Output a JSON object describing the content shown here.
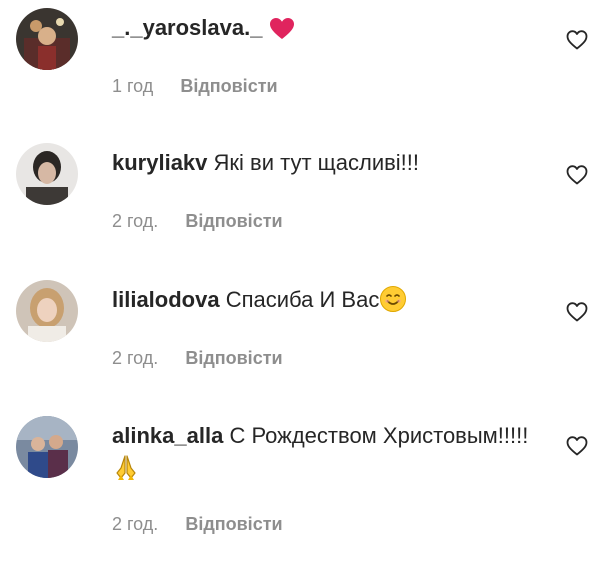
{
  "comments": [
    {
      "username": "_._yaroslava._",
      "text": "",
      "time": "1 год",
      "reply_label": "Відповісти",
      "trailing_icon": "red-heart-emoji"
    },
    {
      "username": "kuryliakv",
      "text": "Які ви тут щасливі!!!",
      "time": "2 год.",
      "reply_label": "Відповісти"
    },
    {
      "username": "lilialodova",
      "text": "Спасиба И Вас",
      "time": "2 год.",
      "reply_label": "Відповісти",
      "trailing_icon": "smiling-face-emoji"
    },
    {
      "username": "alinka_alla",
      "text": "С Рождеством Христовым!!!!!",
      "time": "2 год.",
      "reply_label": "Відповісти",
      "trailing_icon": "folded-hands-emoji"
    }
  ],
  "icons": {
    "like": "heart-outline-icon"
  },
  "colors": {
    "text": "#262626",
    "muted": "#8e8e8e",
    "heart_red": "#e0245e",
    "emoji_yellow": "#ffcc33"
  }
}
